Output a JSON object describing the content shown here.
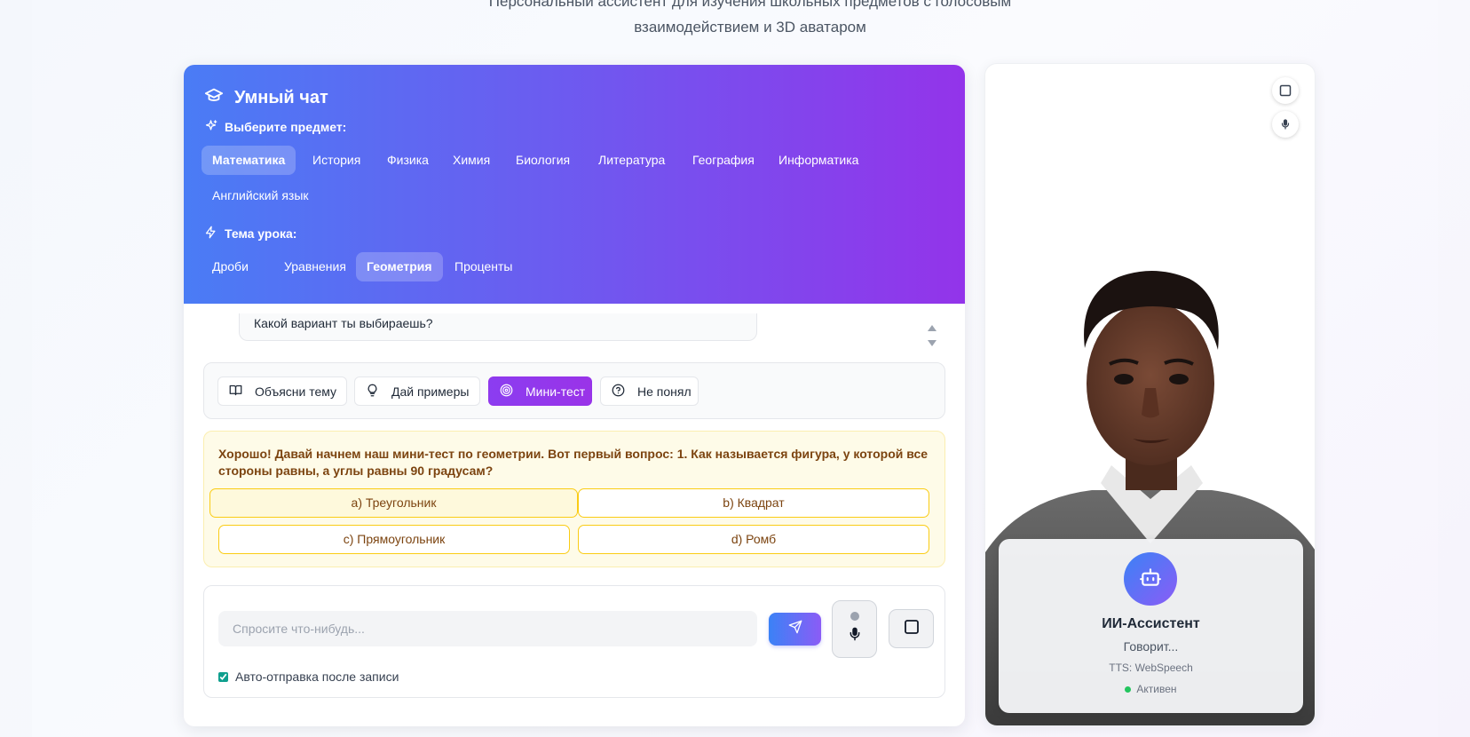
{
  "page": {
    "subtitle_line1": "Персональный ассистент для изучения школьных предметов с голосовым",
    "subtitle_line2": "взаимодействием и 3D аватаром"
  },
  "chat": {
    "title": "Умный чат",
    "subject_label": "Выберите предмет:",
    "subjects": [
      "Математика",
      "История",
      "Физика",
      "Химия",
      "Биология",
      "Литература",
      "География",
      "Информатика",
      "Английский язык"
    ],
    "active_subject": "Математика",
    "topic_label": "Тема урока:",
    "topics": [
      "Дроби",
      "Уравнения",
      "Геометрия",
      "Проценты"
    ],
    "active_topic": "Геометрия",
    "last_message": "Какой вариант ты выбираешь?",
    "quick_actions": [
      "Объясни тему",
      "Дай примеры",
      "Мини-тест",
      "Не понял"
    ],
    "active_quick_action": "Мини-тест",
    "quiz": {
      "question": "Хорошо! Давай начнем наш мини-тест по геометрии. Вот первый вопрос: 1. Как называется фигура, у которой все стороны равны, а углы равны 90 градусам?",
      "options": [
        "a) Треугольник",
        "b) Квадрат",
        "c) Прямоугольник",
        "d) Ромб"
      ]
    },
    "input": {
      "placeholder": "Спросите что-нибудь...",
      "value": ""
    },
    "auto_send_label": "Авто-отправка после записи",
    "auto_send_checked": true
  },
  "assistant": {
    "name": "ИИ-Ассистент",
    "status": "Говорит...",
    "tts": "TTS: WebSpeech",
    "state": "Активен"
  },
  "colors": {
    "header_gradient_start": "#4a7cf5",
    "header_gradient_end": "#9334ea",
    "accent_purple": "#9333ea",
    "quiz_text": "#7c4410",
    "quiz_border": "#facc15",
    "active_dot": "#22c55e"
  }
}
